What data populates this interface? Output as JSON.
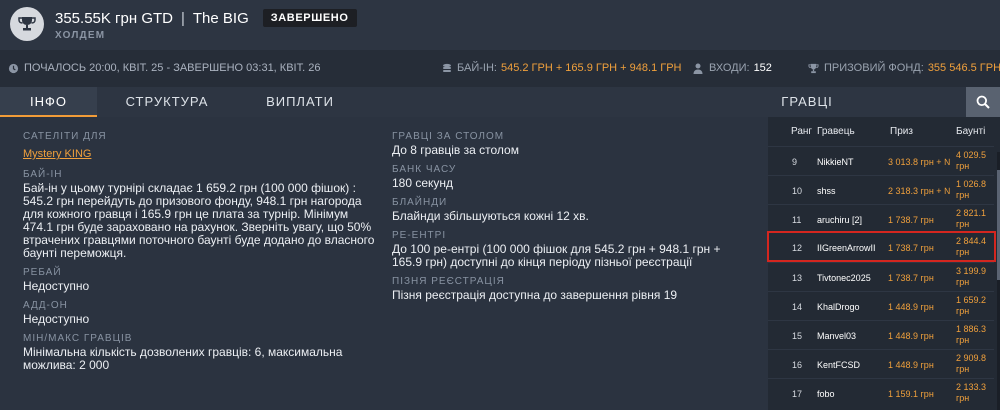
{
  "header": {
    "title": "355.55K грн GTD",
    "separator": "|",
    "name": "The BIG",
    "status": "ЗАВЕРШЕНО",
    "game": "ХОЛДЕМ",
    "icon": "trophy-icon"
  },
  "infobar": {
    "schedule": "ПОЧАЛОСЬ 20:00, КВІТ. 25 - ЗАВЕРШЕНО 03:31, КВІТ. 26",
    "buyin_label": "БАЙ-ІН:",
    "buyin_value": "545.2 ГРН + 165.9 ГРН + 948.1 ГРН",
    "entries_label": "ВХОДИ:",
    "entries_value": "152",
    "prize_label": "ПРИЗОВИЙ ФОНД:",
    "prize_value": "355 546.5 ГРН"
  },
  "tabs": {
    "info": "ІНФО",
    "structure": "СТРУКТУРА",
    "payouts": "ВИПЛАТИ",
    "players": "ГРАВЦІ"
  },
  "info": {
    "satellites_label": "САТЕЛІТИ ДЛЯ",
    "satellites_link": "Mystery KING",
    "buyin_label": "БАЙ-ІН",
    "buyin_text": "Бай-ін у цьому турнірі складає 1 659.2 грн (100 000 фішок) : 545.2 грн перейдуть до призового фонду, 948.1 грн нагорода для кожного гравця і 165.9 грн це плата за турнір. Мінімум 474.1 грн буде зараховано на рахунок. Зверніть увагу, що 50% втрачених гравцями поточного баунті буде додано до власного баунті переможця.",
    "rebuy_label": "РЕБАЙ",
    "rebuy_text": "Недоступно",
    "addon_label": "АДД-ОН",
    "addon_text": "Недоступно",
    "minmax_label": "МІН/МАКС ГРАВЦІВ",
    "minmax_text": "Мінімальна кількість дозволених гравців: 6, максимальна можлива: 2 000",
    "players_table_label": "ГРАВЦІ ЗА СТОЛОМ",
    "players_table_text": "До 8 гравців за столом",
    "timebank_label": "БАНК ЧАСУ",
    "timebank_text": "180 секунд",
    "blinds_label": "БЛАЙНДИ",
    "blinds_text": "Блайнди збільшуються кожні 12 хв.",
    "reentry_label": "РЕ-ЕНТРІ",
    "reentry_text": "До 100 ре-ентрі (100 000 фішок для 545.2 грн + 948.1 грн + 165.9 грн) доступні до кінця періоду пізньої реєстрації",
    "latereg_label": "ПІЗНЯ РЕЄСТРАЦІЯ",
    "latereg_text": "Пізня реєстрація доступна до завершення рівня 19"
  },
  "players": {
    "col_rank": "Ранг",
    "col_player": "Гравець",
    "col_prize": "Приз",
    "col_bounty": "Баунті",
    "rows": [
      {
        "rank": "9",
        "name": "NikkieNT",
        "prize": "3 013.8 грн + №",
        "bounty": "4 029.5 грн"
      },
      {
        "rank": "10",
        "name": "shss",
        "prize": "2 318.3 грн + №",
        "bounty": "1 026.8 грн"
      },
      {
        "rank": "11",
        "name": "aruchiru [2]",
        "prize": "1 738.7 грн",
        "bounty": "2 821.1 грн"
      },
      {
        "rank": "12",
        "name": "IIGreenArrowII",
        "prize": "1 738.7 грн",
        "bounty": "2 844.4 грн"
      },
      {
        "rank": "13",
        "name": "Tivtonec2025",
        "prize": "1 738.7 грн",
        "bounty": "3 199.9 грн"
      },
      {
        "rank": "14",
        "name": "KhalDrogo",
        "prize": "1 448.9 грн",
        "bounty": "1 659.2 грн"
      },
      {
        "rank": "15",
        "name": "Manvel03",
        "prize": "1 448.9 грн",
        "bounty": "1 886.3 грн"
      },
      {
        "rank": "16",
        "name": "KentFCSD",
        "prize": "1 448.9 грн",
        "bounty": "2 909.8 грн"
      },
      {
        "rank": "17",
        "name": "fobo",
        "prize": "1 159.1 грн",
        "bounty": "2 133.3 грн"
      }
    ]
  },
  "colors": {
    "accent": "#f0a03c",
    "highlight": "#d4261f"
  }
}
